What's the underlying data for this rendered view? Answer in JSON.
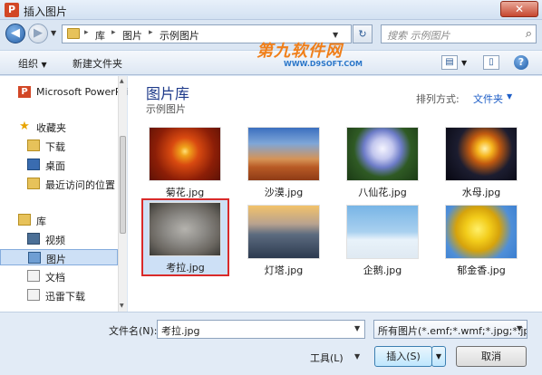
{
  "window": {
    "title": "插入图片",
    "app_icon_letter": "P",
    "close_glyph": "✕"
  },
  "address": {
    "breadcrumbs": [
      "库",
      "图片",
      "示例图片"
    ],
    "search_placeholder": "搜索 示例图片"
  },
  "toolbar": {
    "organize": "组织",
    "new_folder": "新建文件夹"
  },
  "watermark": {
    "main": "第九软件网",
    "sub": "WWW.D9SOFT.COM"
  },
  "sidebar": {
    "items": [
      {
        "label": "Microsoft PowerPoint",
        "icon": "powerpoint-icon"
      },
      {
        "label": "收藏夹",
        "icon": "star-icon"
      },
      {
        "label": "下载",
        "icon": "download-folder-icon"
      },
      {
        "label": "桌面",
        "icon": "desktop-icon"
      },
      {
        "label": "最近访问的位置",
        "icon": "recent-places-icon"
      },
      {
        "label": "库",
        "icon": "library-icon"
      },
      {
        "label": "视频",
        "icon": "videos-icon"
      },
      {
        "label": "图片",
        "icon": "pictures-icon"
      },
      {
        "label": "文档",
        "icon": "documents-icon"
      },
      {
        "label": "迅雷下载",
        "icon": "thunder-download-icon"
      }
    ],
    "selected_index": 7
  },
  "main": {
    "library_title": "图片库",
    "library_subtitle": "示例图片",
    "arrange_label": "排列方式:",
    "arrange_value": "文件夹",
    "files": [
      {
        "name": "菊花.jpg"
      },
      {
        "name": "沙漠.jpg"
      },
      {
        "name": "八仙花.jpg"
      },
      {
        "name": "水母.jpg"
      },
      {
        "name": "考拉.jpg"
      },
      {
        "name": "灯塔.jpg"
      },
      {
        "name": "企鹅.jpg"
      },
      {
        "name": "郁金香.jpg"
      }
    ],
    "selected_file_index": 4
  },
  "bottom": {
    "filename_label": "文件名(N):",
    "filename_value": "考拉.jpg",
    "filter_value": "所有图片(*.emf;*.wmf;*.jpg;*.jp",
    "tools_label": "工具(L)",
    "insert_label": "插入(S)",
    "cancel_label": "取消"
  }
}
